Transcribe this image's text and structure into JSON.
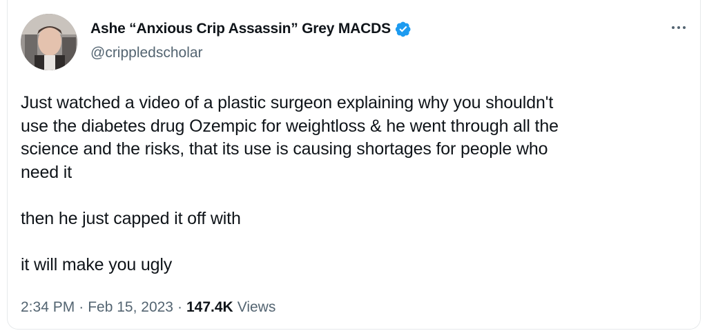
{
  "author": {
    "display_name": "Ashe “Anxious Crip Assassin” Grey MACDS",
    "handle": "@crippledscholar",
    "verified_icon": "verified-badge-icon",
    "verified_color": "#1d9bf0"
  },
  "tweet": {
    "text": "Just watched a video of a plastic surgeon explaining why you shouldn't\nuse the diabetes drug Ozempic for weightloss & he went through all the\nscience and the risks, that its use is causing shortages for people who\nneed it\n\nthen he just capped it off with\n\nit will make you ugly"
  },
  "meta": {
    "time": "2:34 PM",
    "separator_1": "·",
    "date": "Feb 15, 2023",
    "separator_2": "·",
    "views_count": "147.4K",
    "views_label": "Views"
  },
  "menu": {
    "icon": "more-options-icon"
  }
}
